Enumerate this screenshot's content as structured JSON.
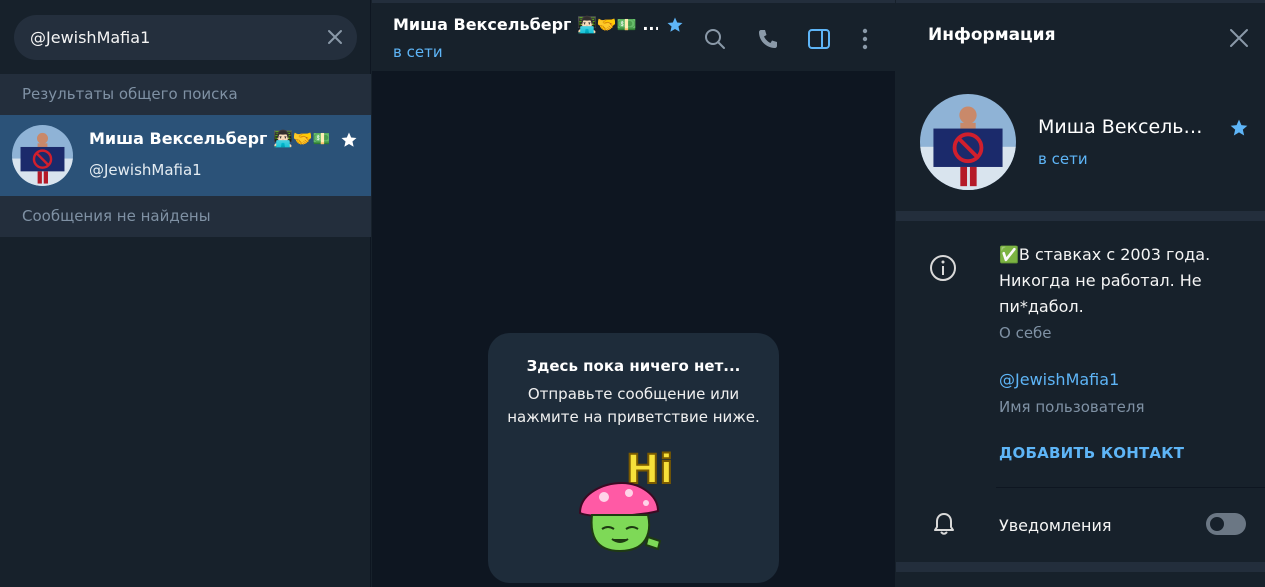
{
  "search": {
    "value": "@JewishMafia1"
  },
  "left": {
    "global_results_header": "Результаты общего поиска",
    "no_messages": "Сообщения не найдены",
    "result": {
      "name": "Миша Вексельберг 👨🏻‍💻🤝💵 Ин…",
      "username": "@JewishMafia1"
    }
  },
  "chat": {
    "name": "Миша Вексельберг 👨🏻‍💻🤝💵 ...",
    "status": "в сети",
    "empty_title": "Здесь пока ничего нет...",
    "empty_text": "Отправьте сообщение или нажмите на приветствие ниже.",
    "sticker_text": "Hi"
  },
  "info": {
    "title": "Информация",
    "name": "Миша Вексель…",
    "status": "в сети",
    "bio": "✅В ставках с 2003 года. Никогда не работал. Не пи*дабол.",
    "bio_label": "О себе",
    "username": "@JewishMafia1",
    "username_label": "Имя пользователя",
    "add_contact": "ДОБАВИТЬ КОНТАКТ",
    "notifications": "Уведомления",
    "notifications_on": false
  },
  "colors": {
    "accent": "#5eb5f7",
    "panel": "#17212b",
    "chat_bg": "#0e1621",
    "selected": "#2b5278",
    "muted": "#7f91a4"
  }
}
